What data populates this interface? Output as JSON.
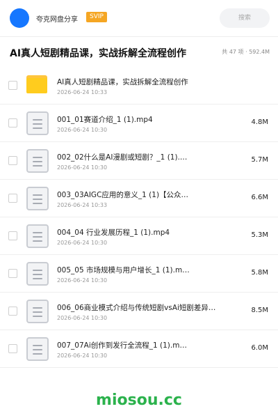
{
  "header": {
    "share_name": "夸克网盘分享",
    "badge": "SVIP",
    "search_placeholder": "搜索"
  },
  "folder": {
    "title": "AI真人短剧精品课，实战拆解全流程创作",
    "meta": "共 47 项 · 592.4M"
  },
  "files": [
    {
      "type": "folder",
      "name": "AI真人短剧精品课，实战拆解全流程创作",
      "date": "2026-06-24 10:33",
      "size": ""
    },
    {
      "type": "file",
      "name": "001_01赛道介绍_1 (1).mp4",
      "date": "2026-06-24 10:30",
      "size": "4.8M"
    },
    {
      "type": "file",
      "name": "002_02什么是AI漫剧或短剧？_1 (1).…",
      "date": "2026-06-24 10:30",
      "size": "5.7M"
    },
    {
      "type": "file",
      "name": "003_03AIGC应用的意义_1 (1)【公众…",
      "date": "2026-06-24 10:33",
      "size": "6.6M"
    },
    {
      "type": "file",
      "name": "004_04 行业发展历程_1 (1).mp4",
      "date": "2026-06-24 10:30",
      "size": "5.3M"
    },
    {
      "type": "file",
      "name": "005_05 市场规模与用户增长_1 (1).m…",
      "date": "2026-06-24 10:30",
      "size": "5.8M"
    },
    {
      "type": "file",
      "name": "006_06商业模式介绍与传统短剧vsAi短剧差异…",
      "date": "2026-06-24 10:30",
      "size": "8.5M"
    },
    {
      "type": "file",
      "name": "007_07Ai创作到发行全流程_1 (1).m…",
      "date": "2026-06-24 10:30",
      "size": "6.0M"
    }
  ],
  "watermark": "miosou.cc",
  "colors": {
    "accent": "#1677ff",
    "badge": "#f5a623",
    "folder": "#ffcc1e",
    "watermark": "#2bb24c"
  }
}
